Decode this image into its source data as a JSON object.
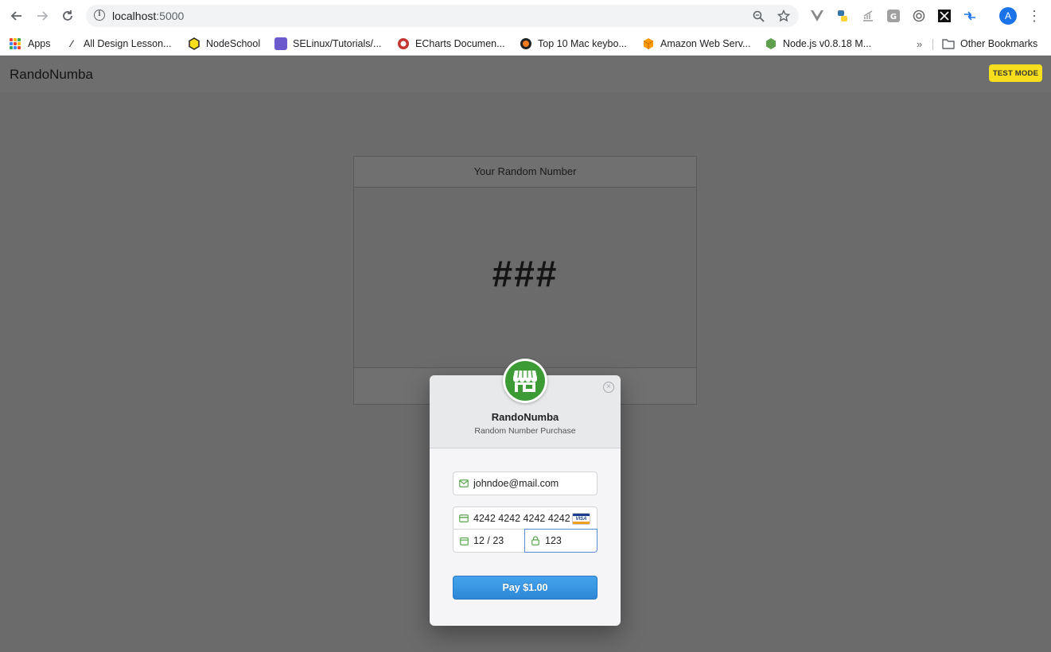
{
  "browser": {
    "url_host": "localhost",
    "url_port": ":5000",
    "bookmarks": [
      {
        "label": "Apps",
        "color": "#ea4335"
      },
      {
        "label": "All Design Lesson...",
        "color": "#333333"
      },
      {
        "label": "NodeSchool",
        "color": "#f7df1e"
      },
      {
        "label": "SELinux/Tutorials/...",
        "color": "#6a5acd"
      },
      {
        "label": "ECharts Documen...",
        "color": "#c23531"
      },
      {
        "label": "Top 10 Mac keybo...",
        "color": "#f47b20"
      },
      {
        "label": "Amazon Web Serv...",
        "color": "#ff9900"
      },
      {
        "label": "Node.js v0.8.18 M...",
        "color": "#5fa04e"
      }
    ],
    "other_bookmarks": "Other Bookmarks",
    "more": "»",
    "avatar_letter": "A"
  },
  "app": {
    "brand": "RandoNumba",
    "test_mode": "TEST MODE"
  },
  "card": {
    "header": "Your Random Number",
    "number": "###"
  },
  "checkout": {
    "title": "RandoNumba",
    "subtitle": "Random Number Purchase",
    "email": "johndoe@mail.com",
    "card_number": "4242 4242 4242 4242",
    "expiry": "12 / 23",
    "cvc": "123",
    "card_brand": "VISA",
    "pay_label": "Pay $1.00",
    "close_symbol": "×"
  },
  "colors": {
    "overlay": "#6b6b6b",
    "brand_green": "#3d9b35",
    "pay_blue": "#2d87d6",
    "badge_yellow": "#f7df1e"
  }
}
